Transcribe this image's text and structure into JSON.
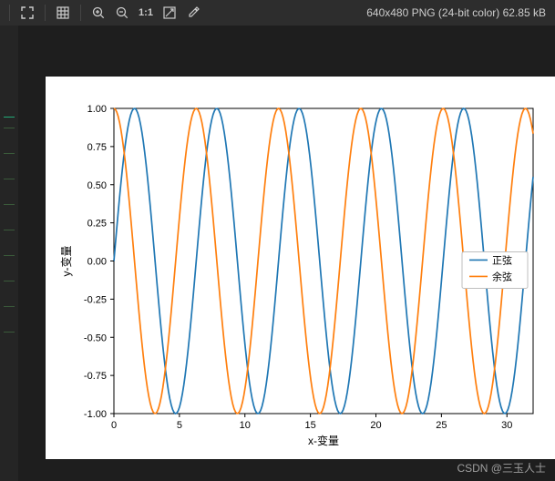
{
  "toolbar": {
    "icons": {
      "fullscreen": "fullscreen-icon",
      "grid": "grid-icon",
      "zoom_in": "zoom-in-icon",
      "zoom_out": "zoom-out-icon",
      "one_to_one": "1:1",
      "fit": "fit-icon",
      "picker": "eyedropper-icon"
    },
    "status": "640x480 PNG (24-bit color) 62.85 kB"
  },
  "watermark": "CSDN @三玉人士",
  "chart_data": {
    "type": "line",
    "xlabel": "x-变量",
    "ylabel": "y-变量",
    "xlim": [
      0,
      32
    ],
    "ylim": [
      -1.0,
      1.0
    ],
    "xticks": [
      0,
      5,
      10,
      15,
      20,
      25,
      30
    ],
    "yticks": [
      -1.0,
      -0.75,
      -0.5,
      -0.25,
      0.0,
      0.25,
      0.5,
      0.75,
      1.0
    ],
    "legend": {
      "position": "right",
      "entries": [
        "正弦",
        "余弦"
      ]
    },
    "series": [
      {
        "name": "正弦",
        "color": "#1f77b4",
        "function": "sin(x)",
        "x_range": [
          0,
          32
        ],
        "samples": 200
      },
      {
        "name": "余弦",
        "color": "#ff7f0e",
        "function": "cos(x)",
        "x_range": [
          0,
          32
        ],
        "samples": 200
      }
    ],
    "colors": {
      "sin": "#1f77b4",
      "cos": "#ff7f0e",
      "axis": "#000000"
    }
  }
}
